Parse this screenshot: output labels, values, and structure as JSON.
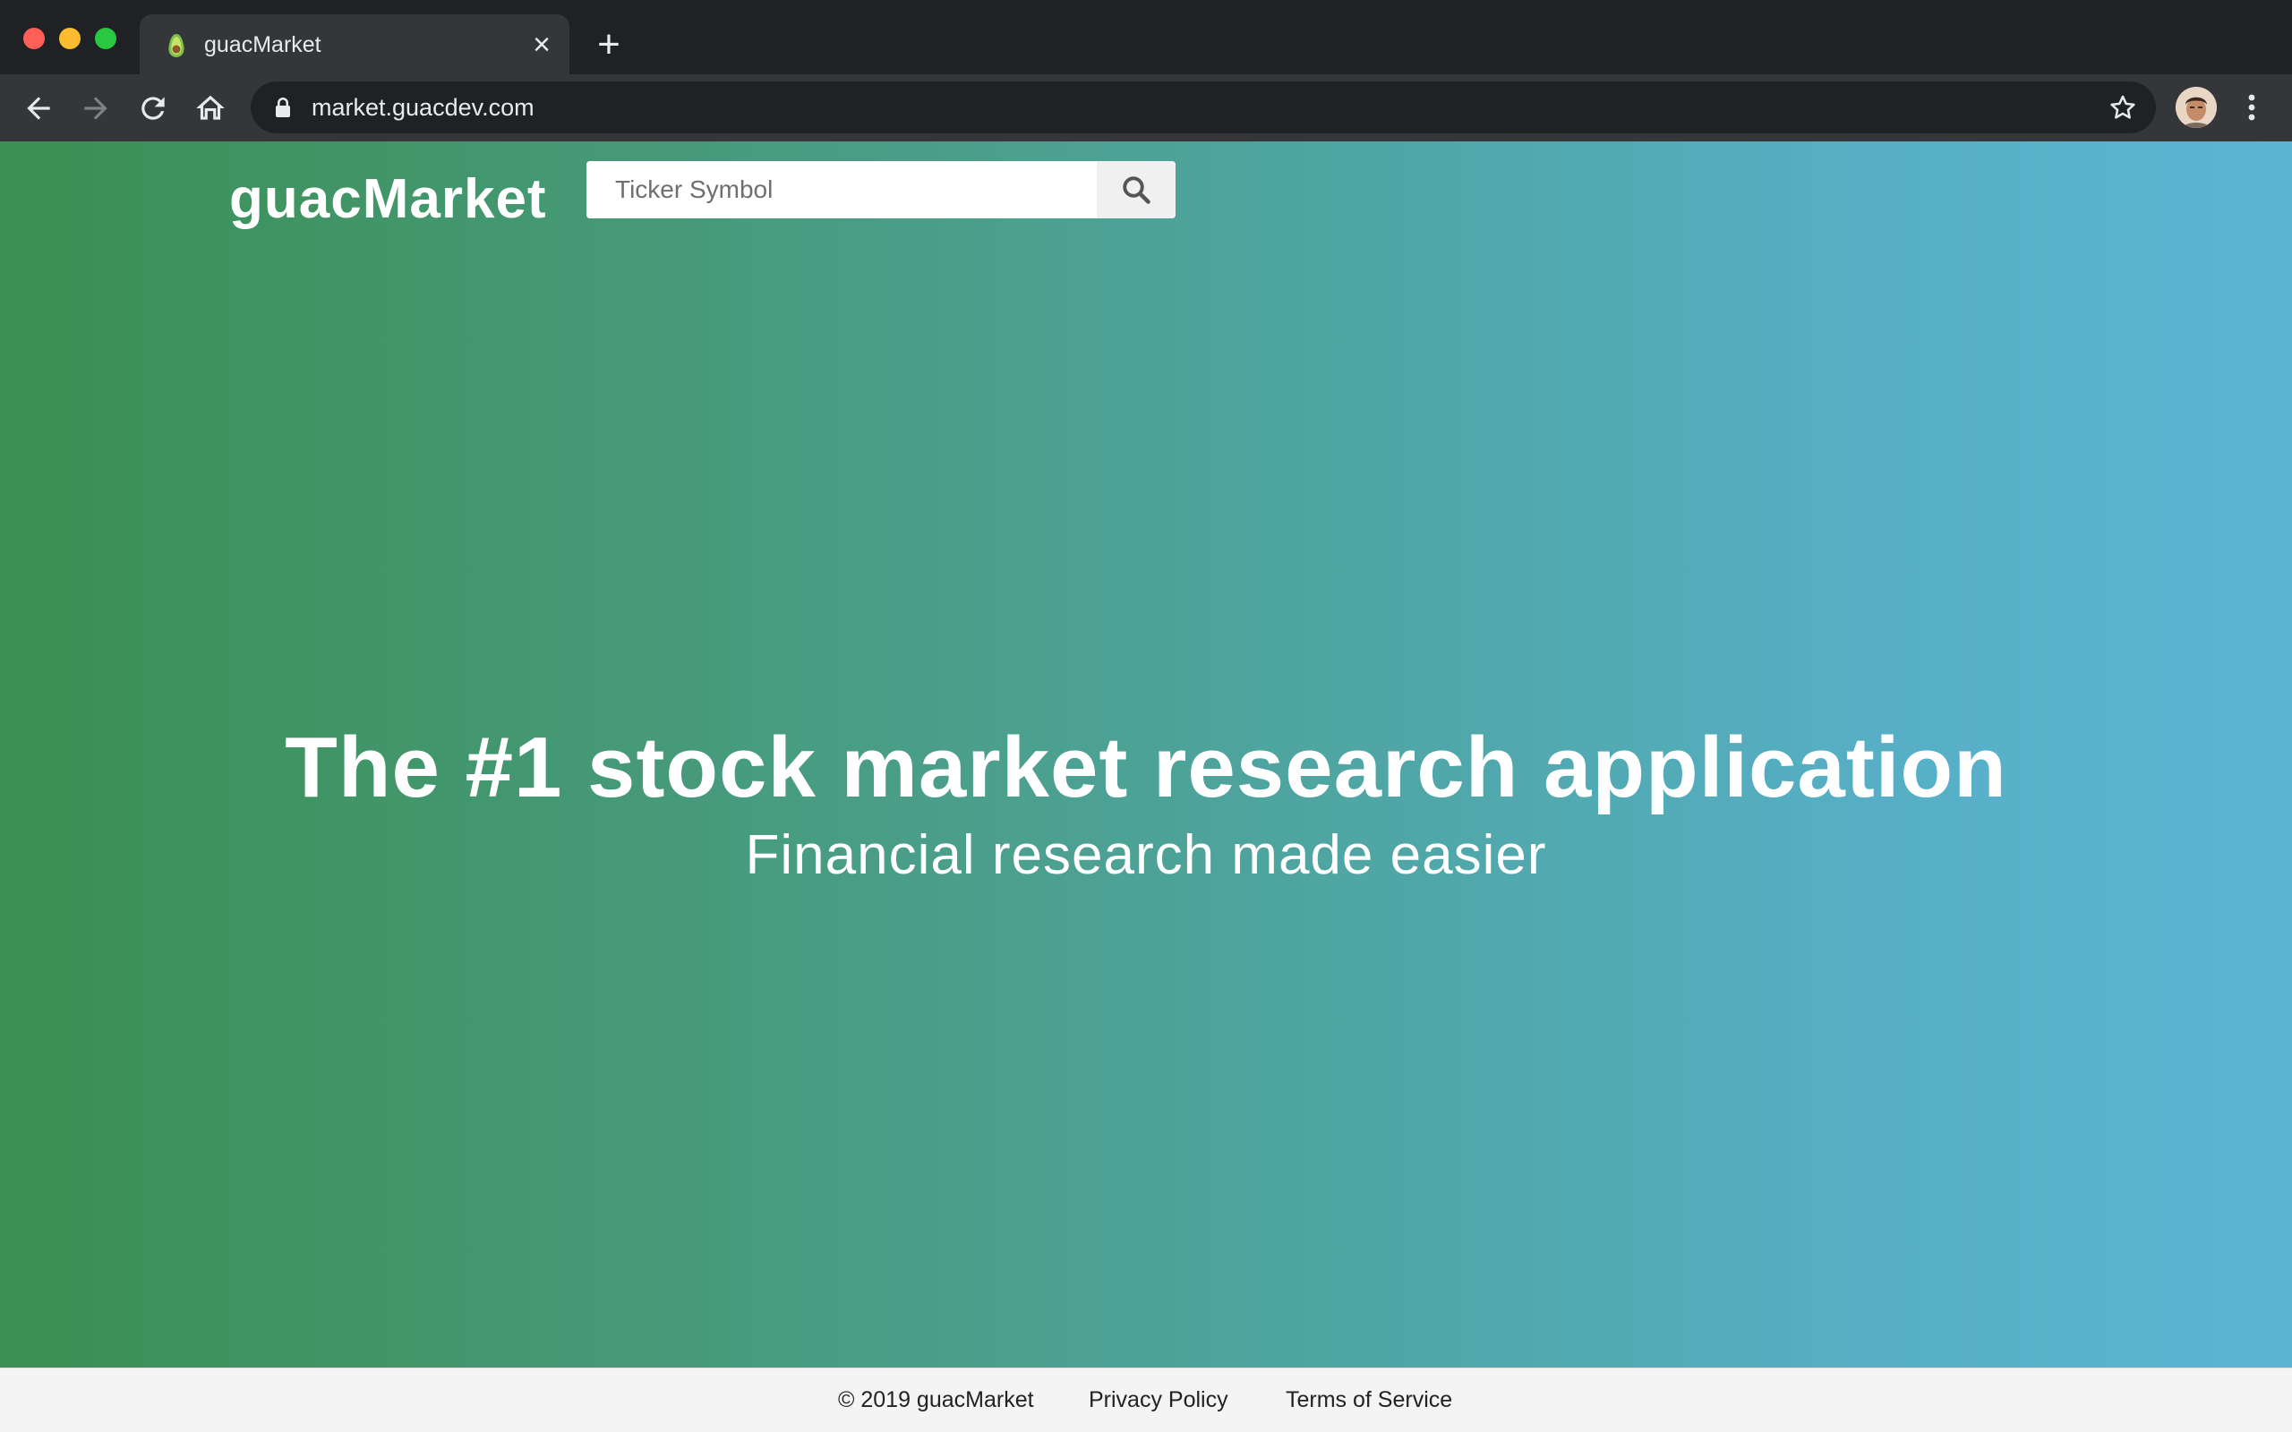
{
  "browser": {
    "tab": {
      "title": "guacMarket",
      "close_label": "×"
    },
    "new_tab_label": "+",
    "address": {
      "url": "market.guacdev.com"
    }
  },
  "site": {
    "brand": "guacMarket",
    "search": {
      "placeholder": "Ticker Symbol"
    },
    "hero": {
      "headline": "The #1 stock market research application",
      "subheadline": "Financial research made easier"
    },
    "footer": {
      "copyright": "© 2019 guacMarket",
      "privacy": "Privacy Policy",
      "terms": "Terms of Service"
    }
  },
  "colors": {
    "gradient_start": "#3b8f52",
    "gradient_end": "#5bb6d4",
    "chrome_dark": "#202124",
    "chrome_toolbar": "#35363a"
  },
  "icons": {
    "favicon": "avocado-icon",
    "search": "search-icon",
    "back": "back-arrow-icon",
    "forward": "forward-arrow-icon",
    "reload": "reload-icon",
    "home": "home-icon",
    "lock": "lock-icon",
    "bookmark": "star-icon",
    "menu": "kebab-menu-icon"
  }
}
